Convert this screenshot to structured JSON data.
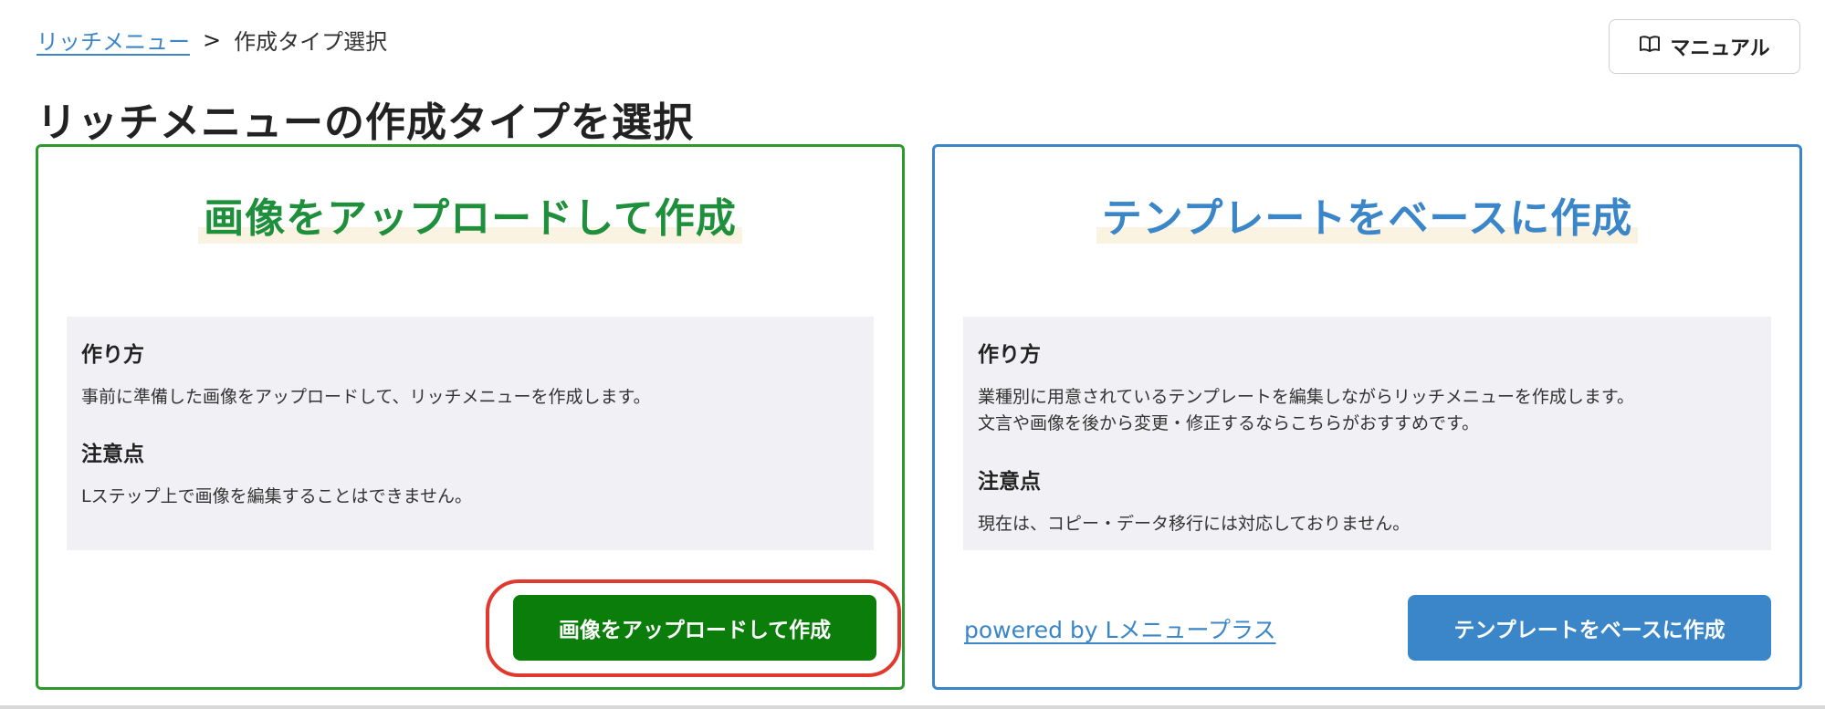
{
  "breadcrumb": {
    "parent": "リッチメニュー",
    "separator": ">",
    "current": "作成タイプ選択"
  },
  "manual_button": {
    "label": "マニュアル",
    "icon": "book-icon"
  },
  "page_title": "リッチメニューの作成タイプを選択",
  "upload_card": {
    "title": "画像をアップロードして作成",
    "how_heading": "作り方",
    "how_text": "事前に準備した画像をアップロードして、リッチメニューを作成します。",
    "note_heading": "注意点",
    "note_text": "Lステップ上で画像を編集することはできません。",
    "button_label": "画像をアップロードして作成",
    "color": "#2e9a2e"
  },
  "template_card": {
    "title": "テンプレートをベースに作成",
    "how_heading": "作り方",
    "how_text": "業種別に用意されているテンプレートを編集しながらリッチメニューを作成します。\n文言や画像を後から変更・修正するならこちらがおすすめです。",
    "note_heading": "注意点",
    "note_text": "現在は、コピー・データ移行には対応しておりません。",
    "powered_link": "powered by Lメニュープラス",
    "button_label": "テンプレートをベースに作成",
    "color": "#3a86c8"
  }
}
